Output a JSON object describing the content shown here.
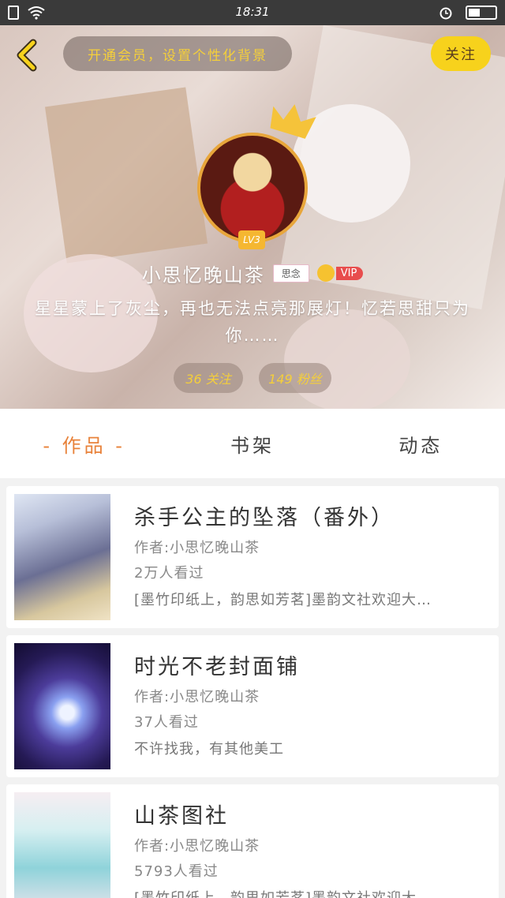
{
  "status_bar": {
    "time": "18:31",
    "battery_level": 0.45
  },
  "header": {
    "member_promo": "开通会员，设置个性化背景",
    "follow_label": "关注",
    "level": "LV3",
    "user_name": "小思忆晚山茶",
    "name_tag": "思念",
    "vip_label": "VIP",
    "bio": "星星蒙上了灰尘，再也无法点亮那展灯！忆若思甜只为你……",
    "following": "36 关注",
    "fans": "149 粉丝"
  },
  "tabs": [
    {
      "label": "- 作品 -",
      "active": true
    },
    {
      "label": "书架",
      "active": false
    },
    {
      "label": "动态",
      "active": false
    }
  ],
  "works": [
    {
      "title": "杀手公主的坠落（番外）",
      "author": "作者:小思忆晚山茶",
      "views": "2万人看过",
      "desc": "[墨竹印纸上，韵思如芳茗]墨韵文社欢迎大…"
    },
    {
      "title": "时光不老封面铺",
      "author": "作者:小思忆晚山茶",
      "views": "37人看过",
      "desc": "不许找我，有其他美工"
    },
    {
      "title": "山茶图社",
      "author": "作者:小思忆晚山茶",
      "views": "5793人看过",
      "desc": "[墨竹印纸上，韵思如芳茗]墨韵文社欢迎大…"
    }
  ],
  "colors": {
    "accent": "#e8823a",
    "gold": "#f7d21c",
    "vip_red": "#e84d4d"
  }
}
